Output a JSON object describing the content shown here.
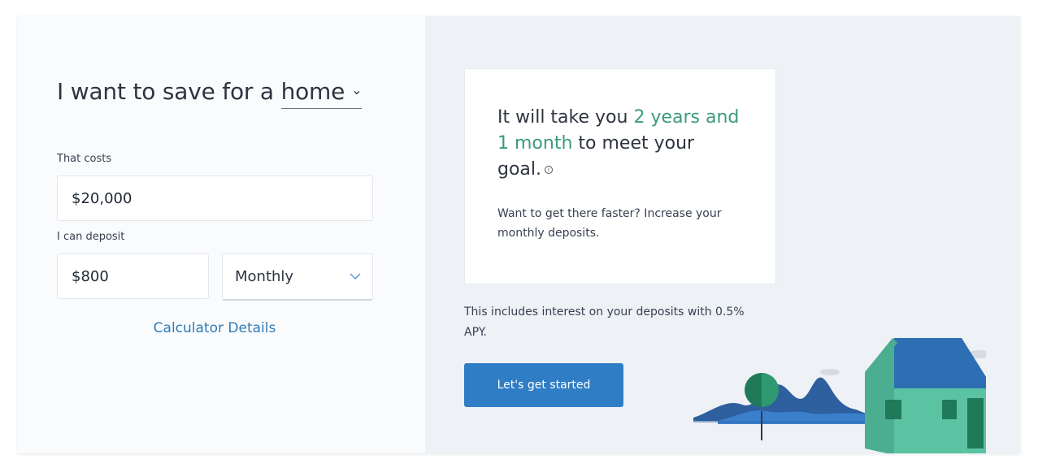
{
  "goal": {
    "prefix": "I want to save for a",
    "selected": "home"
  },
  "cost": {
    "label": "That costs",
    "value": "$20,000"
  },
  "deposit": {
    "label": "I can deposit",
    "value": "$800",
    "frequency": "Monthly"
  },
  "calculator_link": "Calculator Details",
  "result": {
    "text_before": "It will take you ",
    "highlight": "2 years and 1 month",
    "text_after": " to meet your goal.",
    "info_icon": "i",
    "faster": "Want to get there faster? Increase your monthly deposits."
  },
  "interest_note": "This includes interest on your deposits with 0.5% APY.",
  "cta_label": "Let's get started",
  "icons": {
    "goal_chevron": "chevron-down-icon",
    "frequency_chevron": "chevron-down-icon",
    "info": "info-icon"
  },
  "colors": {
    "accent_blue": "#2f7dc4",
    "link_blue": "#2f7bb7",
    "highlight_green": "#3b9b7c",
    "house_green": "#4cae91",
    "roof_blue": "#2e6fb4"
  }
}
